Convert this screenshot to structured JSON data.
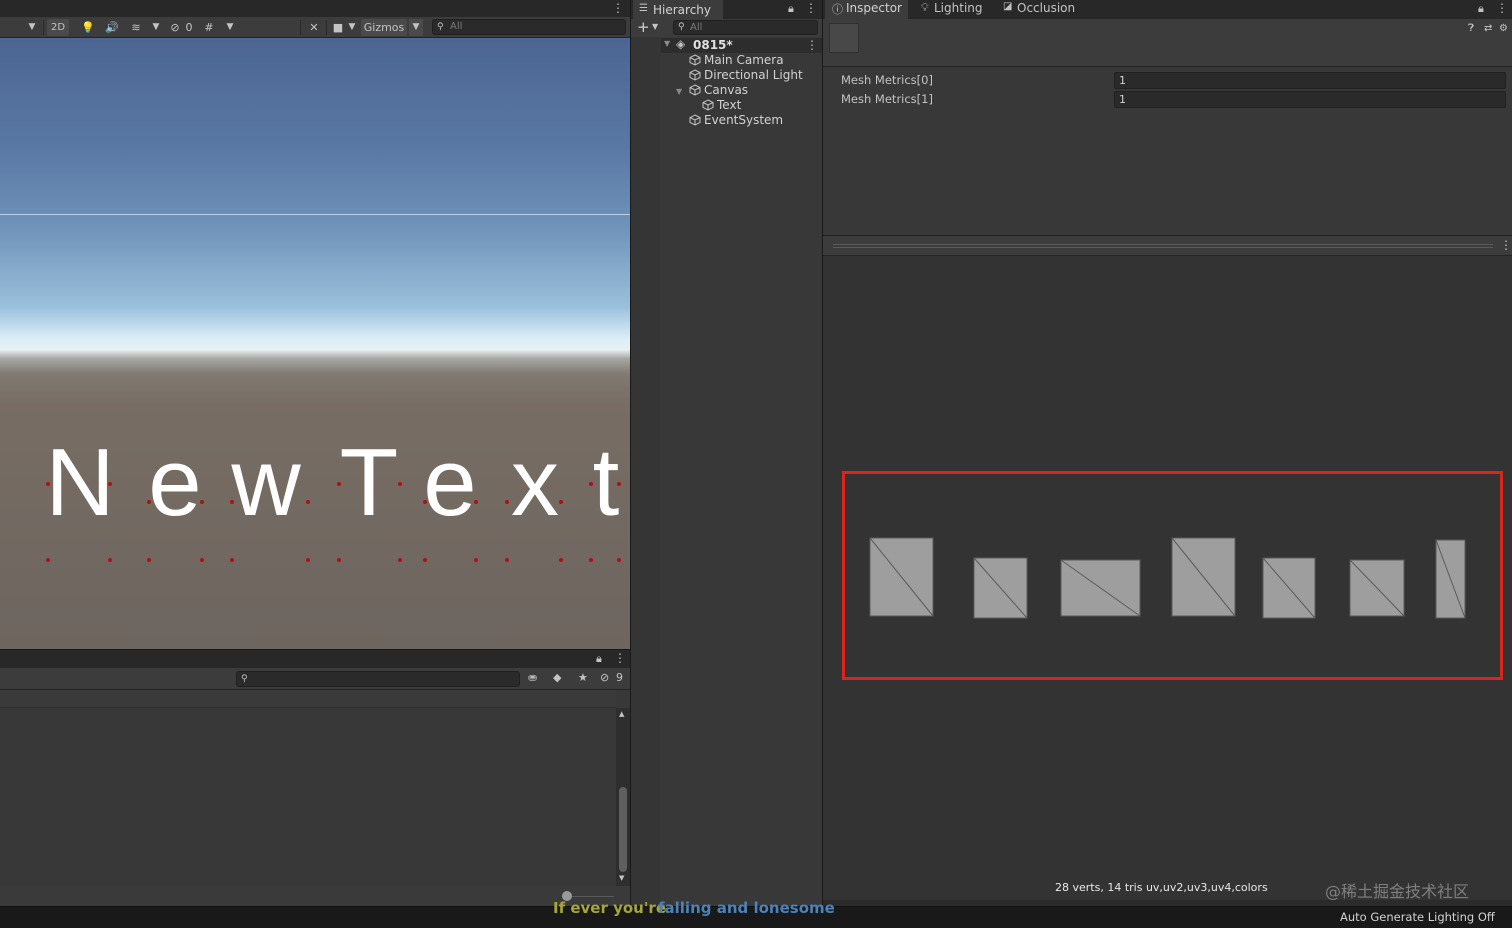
{
  "scene": {
    "toolbar": {
      "mode_2d": "2D",
      "hidden_count": "0",
      "gizmos_label": "Gizmos",
      "search_placeholder": "All"
    },
    "text_object": "NewText",
    "glyphs": [
      "N",
      "e",
      "w",
      "T",
      "e",
      "x",
      "t"
    ]
  },
  "console": {
    "hidden_count": "9"
  },
  "hierarchy": {
    "tab_label": "Hierarchy",
    "search_placeholder": "All",
    "scene_name": "0815*",
    "items": [
      {
        "label": "Main Camera"
      },
      {
        "label": "Directional Light"
      },
      {
        "label": "Canvas"
      },
      {
        "label": "Text"
      },
      {
        "label": "EventSystem"
      }
    ]
  },
  "inspector": {
    "tabs": [
      {
        "label": "Inspector"
      },
      {
        "label": "Lighting"
      },
      {
        "label": "Occlusion"
      }
    ],
    "fields": [
      {
        "label": "Mesh Metrics[0]",
        "value": "1"
      },
      {
        "label": "Mesh Metrics[1]",
        "value": "1"
      }
    ],
    "preview_info": "28 verts, 14 tris   uv,uv2,uv3,uv4,colors"
  },
  "status": {
    "lighting": "Auto Generate Lighting Off",
    "subtitle_part1": "If ever you're",
    "subtitle_part2": "falling and lonesome",
    "watermark": "@稀土掘金技术社区"
  },
  "colors": {
    "highlight": "#d8261f",
    "panel_bg": "#383838",
    "toolbar_bg": "#3c3c3c",
    "mesh_fill": "#9e9e9e"
  }
}
